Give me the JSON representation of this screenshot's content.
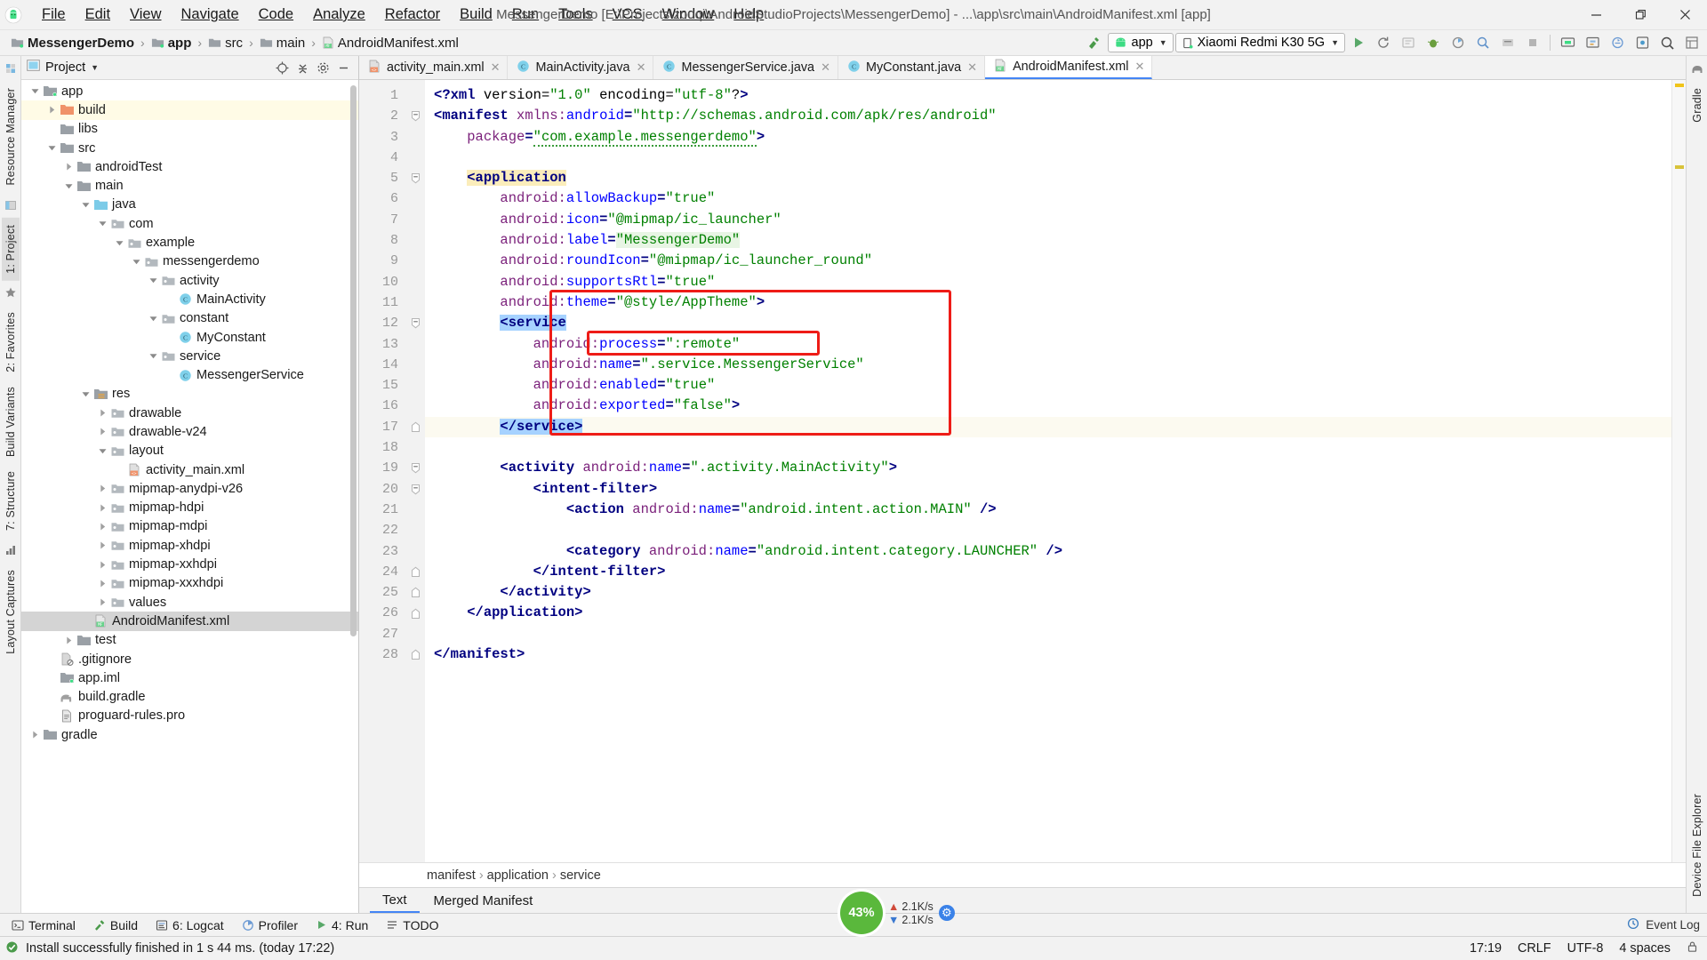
{
  "window": {
    "title": "MessengerDemo [E:\\Projects\\zouqi\\AndroidStudioProjects\\MessengerDemo] - ...\\app\\src\\main\\AndroidManifest.xml [app]",
    "minimize_label": "—",
    "maximize_label": "❐",
    "close_label": "✕"
  },
  "menubar": [
    {
      "label": "File"
    },
    {
      "label": "Edit"
    },
    {
      "label": "View"
    },
    {
      "label": "Navigate"
    },
    {
      "label": "Code"
    },
    {
      "label": "Analyze"
    },
    {
      "label": "Refactor"
    },
    {
      "label": "Build"
    },
    {
      "label": "Run"
    },
    {
      "label": "Tools"
    },
    {
      "label": "VCS"
    },
    {
      "label": "Window"
    },
    {
      "label": "Help"
    }
  ],
  "navbar": {
    "crumbs": [
      "MessengerDemo",
      "app",
      "src",
      "main",
      "AndroidManifest.xml"
    ],
    "separator": "›",
    "run_config": "app",
    "device": "Xiaomi Redmi K30 5G",
    "caret": "▼"
  },
  "project_panel": {
    "title": "Project",
    "caret": "▼",
    "tree": [
      {
        "label": "app",
        "depth": 1,
        "arrow": "down",
        "icon": "module-folder",
        "state": "normal"
      },
      {
        "label": "build",
        "depth": 2,
        "arrow": "right",
        "icon": "folder-orange",
        "state": "highlight"
      },
      {
        "label": "libs",
        "depth": 2,
        "arrow": "none",
        "icon": "folder-gray",
        "state": "normal"
      },
      {
        "label": "src",
        "depth": 2,
        "arrow": "down",
        "icon": "folder-gray",
        "state": "normal"
      },
      {
        "label": "androidTest",
        "depth": 3,
        "arrow": "right",
        "icon": "folder-gray",
        "state": "normal"
      },
      {
        "label": "main",
        "depth": 3,
        "arrow": "down",
        "icon": "folder-gray",
        "state": "normal"
      },
      {
        "label": "java",
        "depth": 4,
        "arrow": "down",
        "icon": "folder-blue",
        "state": "normal"
      },
      {
        "label": "com",
        "depth": 5,
        "arrow": "down",
        "icon": "package",
        "state": "normal"
      },
      {
        "label": "example",
        "depth": 6,
        "arrow": "down",
        "icon": "package",
        "state": "normal"
      },
      {
        "label": "messengerdemo",
        "depth": 7,
        "arrow": "down",
        "icon": "package",
        "state": "normal"
      },
      {
        "label": "activity",
        "depth": 8,
        "arrow": "down",
        "icon": "package",
        "state": "normal"
      },
      {
        "label": "MainActivity",
        "depth": 9,
        "arrow": "none",
        "icon": "java-class",
        "state": "normal"
      },
      {
        "label": "constant",
        "depth": 8,
        "arrow": "down",
        "icon": "package",
        "state": "normal"
      },
      {
        "label": "MyConstant",
        "depth": 9,
        "arrow": "none",
        "icon": "java-class",
        "state": "normal"
      },
      {
        "label": "service",
        "depth": 8,
        "arrow": "down",
        "icon": "package",
        "state": "normal"
      },
      {
        "label": "MessengerService",
        "depth": 9,
        "arrow": "none",
        "icon": "java-class",
        "state": "normal"
      },
      {
        "label": "res",
        "depth": 4,
        "arrow": "down",
        "icon": "res-folder",
        "state": "normal"
      },
      {
        "label": "drawable",
        "depth": 5,
        "arrow": "right",
        "icon": "package",
        "state": "normal"
      },
      {
        "label": "drawable-v24",
        "depth": 5,
        "arrow": "right",
        "icon": "package",
        "state": "normal"
      },
      {
        "label": "layout",
        "depth": 5,
        "arrow": "down",
        "icon": "package",
        "state": "normal"
      },
      {
        "label": "activity_main.xml",
        "depth": 6,
        "arrow": "none",
        "icon": "layout-xml",
        "state": "normal"
      },
      {
        "label": "mipmap-anydpi-v26",
        "depth": 5,
        "arrow": "right",
        "icon": "package",
        "state": "normal"
      },
      {
        "label": "mipmap-hdpi",
        "depth": 5,
        "arrow": "right",
        "icon": "package",
        "state": "normal"
      },
      {
        "label": "mipmap-mdpi",
        "depth": 5,
        "arrow": "right",
        "icon": "package",
        "state": "normal"
      },
      {
        "label": "mipmap-xhdpi",
        "depth": 5,
        "arrow": "right",
        "icon": "package",
        "state": "normal"
      },
      {
        "label": "mipmap-xxhdpi",
        "depth": 5,
        "arrow": "right",
        "icon": "package",
        "state": "normal"
      },
      {
        "label": "mipmap-xxxhdpi",
        "depth": 5,
        "arrow": "right",
        "icon": "package",
        "state": "normal"
      },
      {
        "label": "values",
        "depth": 5,
        "arrow": "right",
        "icon": "package",
        "state": "normal"
      },
      {
        "label": "AndroidManifest.xml",
        "depth": 4,
        "arrow": "none",
        "icon": "manifest-xml",
        "state": "selected"
      },
      {
        "label": "test",
        "depth": 3,
        "arrow": "right",
        "icon": "folder-gray",
        "state": "normal"
      },
      {
        "label": ".gitignore",
        "depth": 2,
        "arrow": "none",
        "icon": "gitignore",
        "state": "normal"
      },
      {
        "label": "app.iml",
        "depth": 2,
        "arrow": "none",
        "icon": "module-folder",
        "state": "normal"
      },
      {
        "label": "build.gradle",
        "depth": 2,
        "arrow": "none",
        "icon": "gradle",
        "state": "normal"
      },
      {
        "label": "proguard-rules.pro",
        "depth": 2,
        "arrow": "none",
        "icon": "file-text",
        "state": "normal"
      },
      {
        "label": "gradle",
        "depth": 1,
        "arrow": "right",
        "icon": "folder-gray",
        "state": "normal"
      }
    ]
  },
  "left_strip": [
    {
      "label": "Resource Manager"
    },
    {
      "label": "1: Project",
      "selected": true
    },
    {
      "label": "2: Favorites"
    },
    {
      "label": "Build Variants"
    },
    {
      "label": "7: Structure"
    },
    {
      "label": "Layout Captures"
    }
  ],
  "right_strip": [
    {
      "label": "Gradle"
    },
    {
      "label": "Device File Explorer"
    }
  ],
  "editor": {
    "tabs": [
      {
        "label": "activity_main.xml",
        "icon": "layout-xml",
        "active": false
      },
      {
        "label": "MainActivity.java",
        "icon": "java-class",
        "active": false
      },
      {
        "label": "MessengerService.java",
        "icon": "java-class",
        "active": false
      },
      {
        "label": "MyConstant.java",
        "icon": "java-class",
        "active": false
      },
      {
        "label": "AndroidManifest.xml",
        "icon": "manifest-xml",
        "active": true
      }
    ],
    "close_glyph": "✕",
    "line_count": 28,
    "current_line": 17,
    "breadcrumbs": [
      "manifest",
      "application",
      "service"
    ],
    "breadcrumb_sep": "›",
    "view_tabs": [
      {
        "label": "Text",
        "active": true
      },
      {
        "label": "Merged Manifest",
        "active": false
      }
    ],
    "code_lines": [
      "<?xml version=\"1.0\" encoding=\"utf-8\"?>",
      "<manifest xmlns:android=\"http://schemas.android.com/apk/res/android\"",
      "    package=\"com.example.messengerdemo\">",
      "",
      "    <application",
      "        android:allowBackup=\"true\"",
      "        android:icon=\"@mipmap/ic_launcher\"",
      "        android:label=\"MessengerDemo\"",
      "        android:roundIcon=\"@mipmap/ic_launcher_round\"",
      "        android:supportsRtl=\"true\"",
      "        android:theme=\"@style/AppTheme\">",
      "        <service",
      "            android:process=\":remote\"",
      "            android:name=\".service.MessengerService\"",
      "            android:enabled=\"true\"",
      "            android:exported=\"false\">",
      "        </service>",
      "",
      "        <activity android:name=\".activity.MainActivity\">",
      "            <intent-filter>",
      "                <action android:name=\"android.intent.action.MAIN\" />",
      "",
      "                <category android:name=\"android.intent.category.LAUNCHER\" />",
      "            </intent-filter>",
      "        </activity>",
      "    </application>",
      "",
      "</manifest>"
    ]
  },
  "bottom_bar": {
    "tabs": [
      {
        "label": "Terminal",
        "icon": "terminal-icon"
      },
      {
        "label": "Build",
        "icon": "hammer-icon"
      },
      {
        "label": "6: Logcat",
        "icon": "logcat-icon"
      },
      {
        "label": "Profiler",
        "icon": "profiler-icon"
      },
      {
        "label": "4: Run",
        "icon": "run-icon"
      },
      {
        "label": "TODO",
        "icon": "todo-icon"
      }
    ],
    "event_log": "Event Log"
  },
  "status_bar": {
    "message": "Install successfully finished in 1 s 44 ms. (today 17:22)",
    "time": "17:19",
    "line_sep": "CRLF",
    "encoding": "UTF-8",
    "indent": "4 spaces"
  },
  "memory_widget": {
    "percent": "43%",
    "net_up": "2.1K/s",
    "net_down": "2.1K/s"
  },
  "colors": {
    "accent_blue": "#4385f5",
    "android_green": "#3ddc84",
    "red_box": "#ee1c17",
    "selection_blue": "#a6d2ff",
    "highlight_yellow": "#fbedbb",
    "memory_green": "#5ab83c"
  }
}
